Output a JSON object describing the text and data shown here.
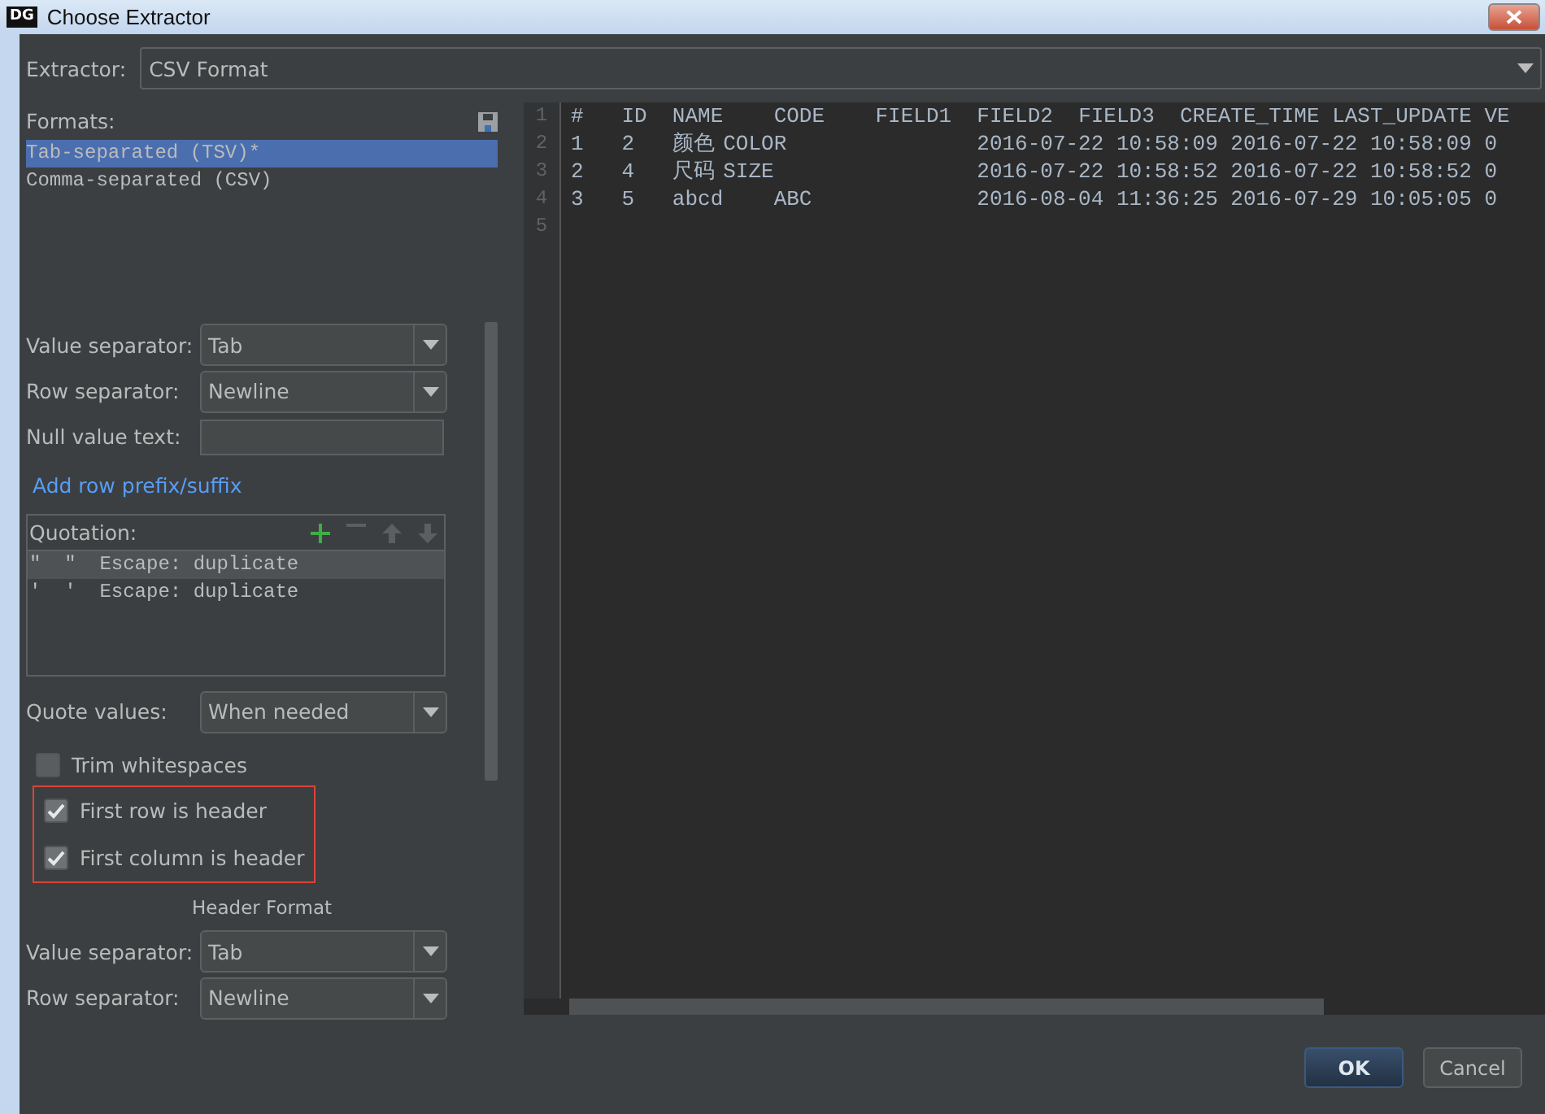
{
  "window": {
    "title": "Choose Extractor",
    "app_badge": "DG"
  },
  "extractor": {
    "label": "Extractor:",
    "value": "CSV Format"
  },
  "formats": {
    "label": "Formats:",
    "items": [
      {
        "label": "Tab-separated (TSV)*",
        "selected": true
      },
      {
        "label": "Comma-separated (CSV)",
        "selected": false
      }
    ]
  },
  "format_fields": [
    {
      "kind": "select",
      "label": "Value separator:",
      "value": "Tab"
    },
    {
      "kind": "select",
      "label": "Row separator:",
      "value": "Newline"
    },
    {
      "kind": "input",
      "label": "Null value text:"
    }
  ],
  "link": "Add row prefix/suffix",
  "quotation": {
    "label": "Quotation:",
    "rows": [
      {
        "text": "\"  \"  Escape: duplicate",
        "selected": true
      },
      {
        "text": "'  '  Escape: duplicate",
        "selected": false
      }
    ]
  },
  "quote_values": {
    "label": "Quote values:",
    "value": "When needed"
  },
  "checkboxes": [
    {
      "label": "Trim whitespaces",
      "checked": false,
      "highlighted": false
    },
    {
      "label": "First row is header",
      "checked": true,
      "highlighted": true
    },
    {
      "label": "First column is header",
      "checked": true,
      "highlighted": true
    }
  ],
  "header_format": {
    "title": "Header Format",
    "fields": [
      {
        "kind": "select",
        "label": "Value separator:",
        "value": "Tab"
      },
      {
        "kind": "select",
        "label": "Row separator:",
        "value": "Newline"
      }
    ]
  },
  "preview": {
    "lines": [
      {
        "number": "1",
        "text": "#\tID\tNAME\tCODE\tFIELD1\tFIELD2\tFIELD3\tCREATE_TIME\tLAST_UPDATE\tVE"
      },
      {
        "number": "2",
        "text": "1\t2\t颜色\tCOLOR\t\t\t\t2016-07-22 10:58:09\t2016-07-22 10:58:09\t0"
      },
      {
        "number": "3",
        "text": "2\t4\t尺码\tSIZE\t\t\t\t2016-07-22 10:58:52\t2016-07-22 10:58:52\t0"
      },
      {
        "number": "4",
        "text": "3\t5\tabcd\tABC\t\t\t\t2016-08-04 11:36:25\t2016-07-29 10:05:05\t0"
      },
      {
        "number": "5"
      }
    ]
  },
  "buttons": [
    {
      "label": "OK",
      "default": true
    },
    {
      "label": "Cancel",
      "default": false
    }
  ]
}
